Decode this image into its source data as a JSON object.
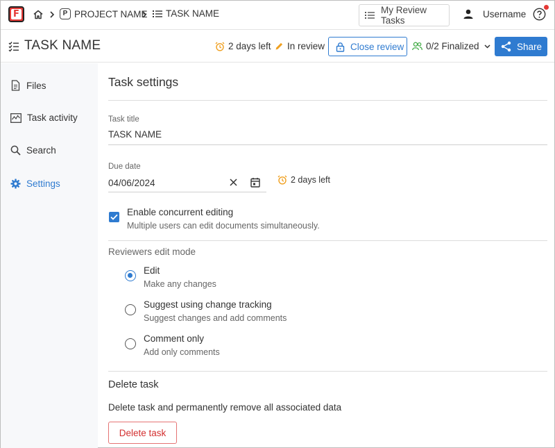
{
  "topbar": {
    "logo_letter": "F",
    "project_badge": "P",
    "project_name": "PROJECT NAME",
    "task_name": "TASK NAME",
    "review_tasks_label": "My Review Tasks",
    "username": "Username"
  },
  "taskbar": {
    "title": "TASK NAME",
    "days_left": "2 days left",
    "status": "In review",
    "close_review_label": "Close review",
    "finalized": "0/2 Finalized",
    "share_label": "Share"
  },
  "sidebar": {
    "items": [
      {
        "label": "Files"
      },
      {
        "label": "Task activity"
      },
      {
        "label": "Search"
      },
      {
        "label": "Settings"
      }
    ]
  },
  "settings": {
    "heading": "Task settings",
    "task_title_label": "Task title",
    "task_title_value": "TASK NAME",
    "due_date_label": "Due date",
    "due_date_value": "04/06/2024",
    "due_days_left": "2 days left",
    "concurrent_title": "Enable concurrent editing",
    "concurrent_desc": "Multiple users can edit documents simultaneously.",
    "concurrent_checked": true,
    "reviewers_label": "Reviewers edit mode",
    "modes": [
      {
        "title": "Edit",
        "desc": "Make any changes",
        "checked": true
      },
      {
        "title": "Suggest using change tracking",
        "desc": "Suggest changes and add comments",
        "checked": false
      },
      {
        "title": "Comment only",
        "desc": "Add only comments",
        "checked": false
      }
    ],
    "delete_heading": "Delete task",
    "delete_desc": "Delete task and permanently remove all associated data",
    "delete_button": "Delete task"
  },
  "colors": {
    "accent": "#2f7bd0",
    "brand": "#e53935",
    "warning": "#f0a020",
    "reviewers_icon": "#4caf50",
    "danger": "#d32f2f"
  }
}
